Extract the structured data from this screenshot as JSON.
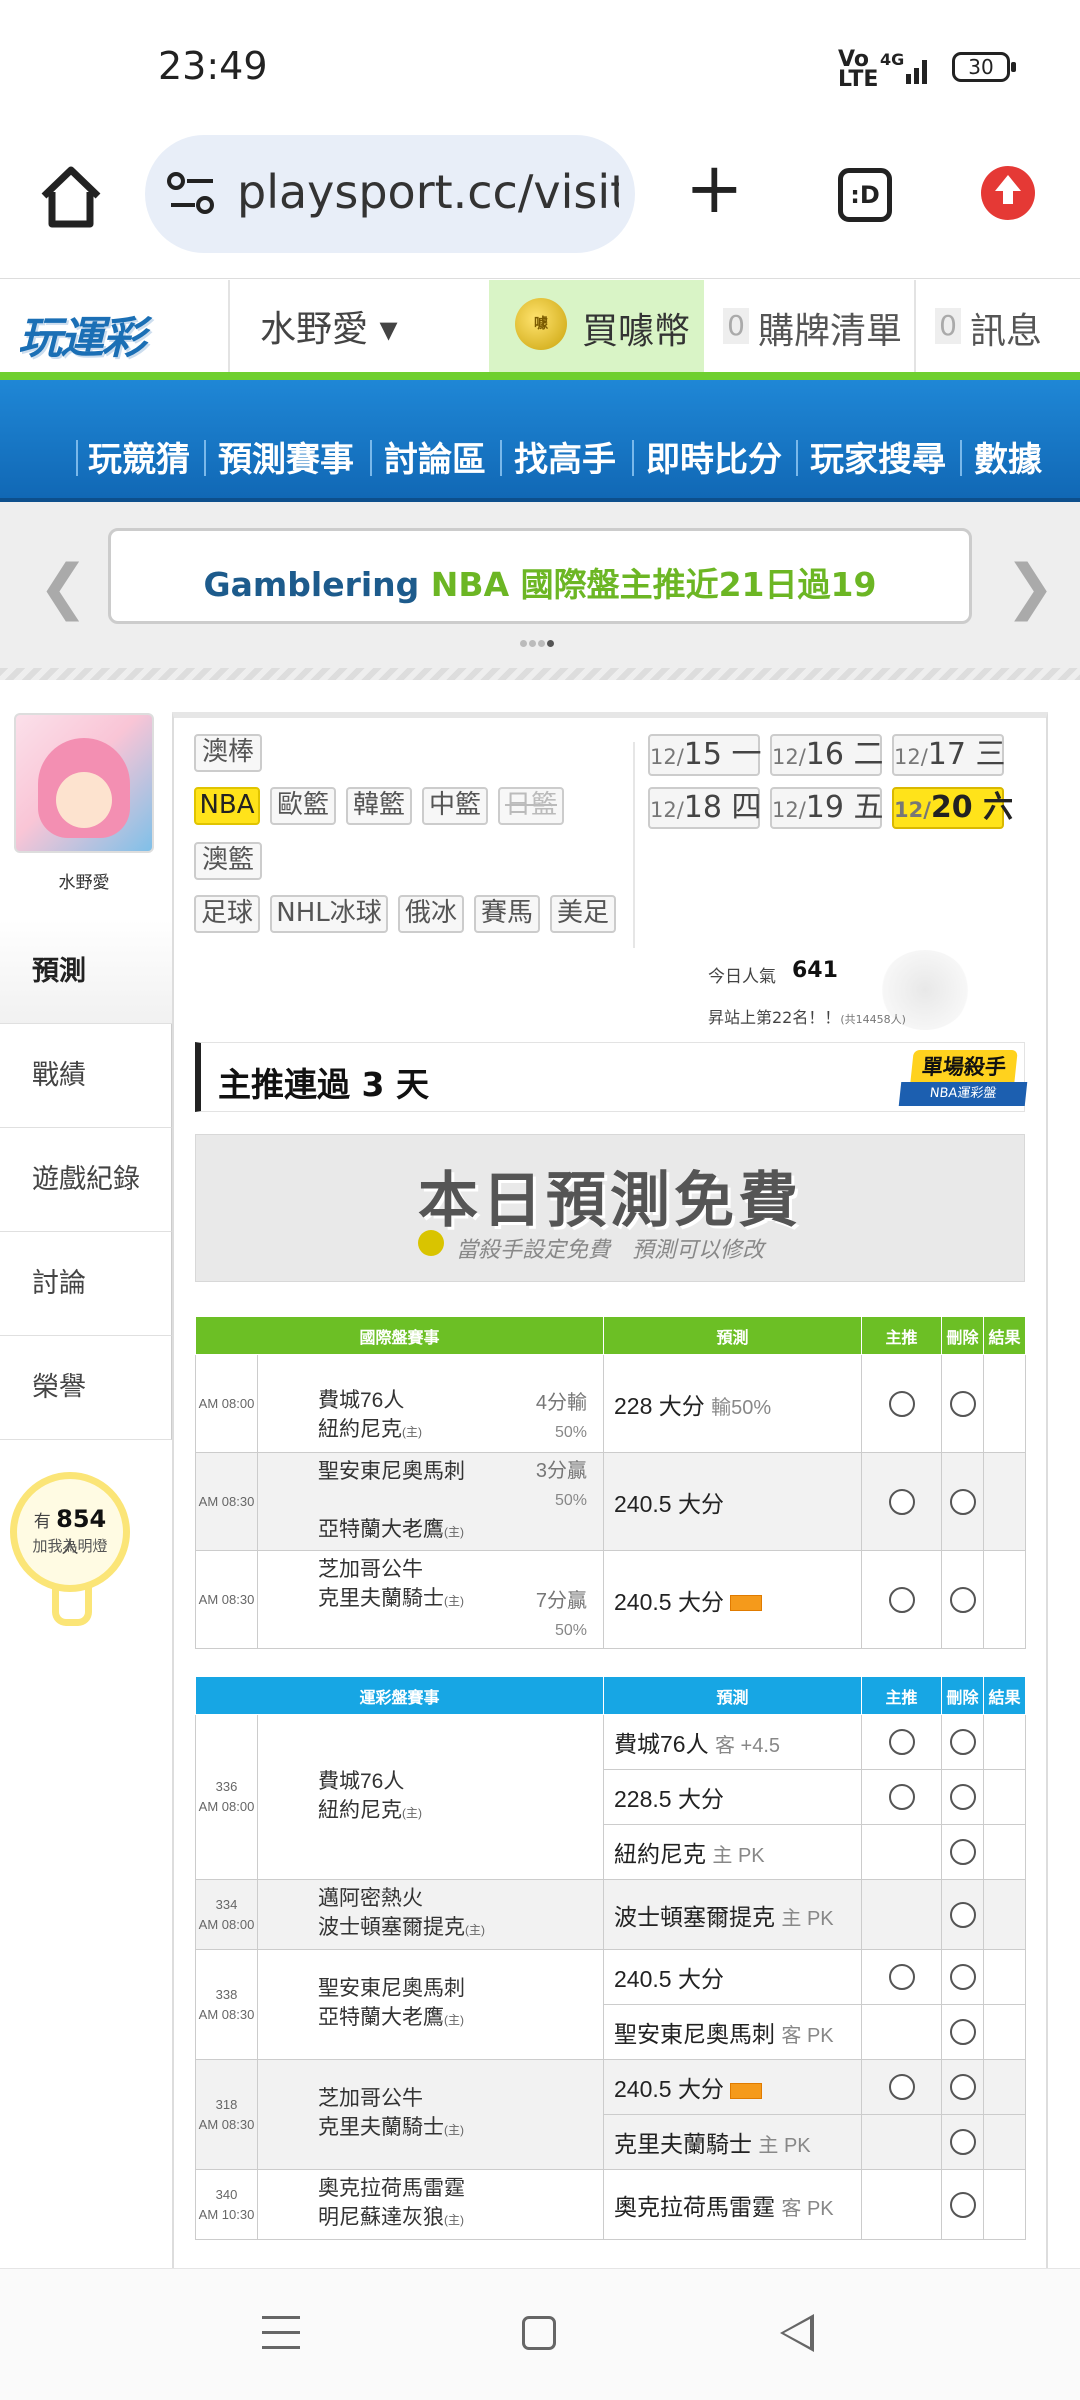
{
  "status_bar": {
    "time": "23:49",
    "network_top": "Vo",
    "network_bottom": "LTE",
    "signal": "4G",
    "battery": "30"
  },
  "browser": {
    "url": "playsport.cc/visit",
    "tabs_icon_label": ":D"
  },
  "site_header": {
    "logo": "玩運彩",
    "username": "水野愛 ▾",
    "buy_coins": "買噱幣",
    "coin_badge": "噱",
    "cart_count": "0",
    "cart_label": "購牌清單",
    "message_count": "0",
    "message_label": "訊息",
    "colors": {
      "brand_blue": "#1b6fb5",
      "accent_green": "#6cbf25"
    }
  },
  "nav": [
    "玩競猜",
    "預測賽事",
    "討論區",
    "找高手",
    "即時比分",
    "玩家搜尋",
    "數據"
  ],
  "banner": {
    "part1": "Gamblering",
    "part2": "NBA 國際盤主推近21日過19"
  },
  "profile": {
    "name": "水野愛"
  },
  "side_tabs": [
    "預測",
    "戰績",
    "遊戲紀錄",
    "討論",
    "榮譽"
  ],
  "fans": {
    "prefix": "有",
    "count": "854",
    "suffix": "人",
    "line2": "加我為明燈"
  },
  "leagues": {
    "row1": [
      "澳棒"
    ],
    "row2": [
      "NBA",
      "歐籃",
      "韓籃",
      "中籃",
      "日籃"
    ],
    "row3": [
      "澳籃"
    ],
    "row4": [
      "足球",
      "NHL冰球",
      "俄冰",
      "賽馬",
      "美足"
    ]
  },
  "dates": [
    {
      "md": "12/",
      "day": "15",
      "wd": "一"
    },
    {
      "md": "12/",
      "day": "16",
      "wd": "二"
    },
    {
      "md": "12/",
      "day": "17",
      "wd": "三"
    },
    {
      "md": "12/",
      "day": "18",
      "wd": "四"
    },
    {
      "md": "12/",
      "day": "19",
      "wd": "五"
    },
    {
      "md": "12/",
      "day": "20",
      "wd": "六"
    }
  ],
  "popularity": {
    "label": "今日人氣",
    "value": "641",
    "rank": "昇站上第22名！！",
    "rank_note": "(共14458人)"
  },
  "streak": {
    "text": "主推連過 3 天",
    "badge_top": "單場殺手",
    "badge_bottom": "NBA運彩盤"
  },
  "free": {
    "title": "本日預測免費",
    "subtitle": "當殺手設定免費　預測可以修改"
  },
  "intl_table": {
    "headers": [
      "國際盤賽事",
      "預測",
      "主推",
      "刪除",
      "結果"
    ],
    "rows": [
      {
        "time": "AM 08:00",
        "team1": "費城76人",
        "team2": "紐約尼克",
        "home_mark": "(主)",
        "spread": "4分輸",
        "spread_pct": "50%",
        "pick": "228 大分",
        "pick_note": "輸50%"
      },
      {
        "time": "AM 08:30",
        "team1": "聖安東尼奧馬刺",
        "team2": "亞特蘭大老鷹",
        "home_mark": "(主)",
        "spread": "3分贏",
        "spread_pct": "50%",
        "pick": "240.5 大分",
        "pick_note": ""
      },
      {
        "time": "AM 08:30",
        "team1": "芝加哥公牛",
        "team2": "克里夫蘭騎士",
        "home_mark": "(主)",
        "spread": "7分贏",
        "spread_pct": "50%",
        "pick": "240.5 大分",
        "pick_note": ""
      }
    ]
  },
  "lottery_table": {
    "headers": [
      "運彩盤賽事",
      "預測",
      "主推",
      "刪除",
      "結果"
    ],
    "games": [
      {
        "num": "336",
        "time": "AM 08:00",
        "team1": "費城76人",
        "team2": "紐約尼克",
        "home_mark": "(主)",
        "picks": [
          {
            "text": "費城76人",
            "note": "客 +4.5"
          },
          {
            "text": "228.5 大分",
            "note": ""
          },
          {
            "text": "紐約尼克",
            "note": "主 PK"
          }
        ]
      },
      {
        "num": "334",
        "time": "AM 08:00",
        "team1": "邁阿密熱火",
        "team2": "波士頓塞爾提克",
        "home_mark": "(主)",
        "picks": [
          {
            "text": "波士頓塞爾提克",
            "note": "主 PK"
          }
        ]
      },
      {
        "num": "338",
        "time": "AM 08:30",
        "team1": "聖安東尼奧馬刺",
        "team2": "亞特蘭大老鷹",
        "home_mark": "(主)",
        "picks": [
          {
            "text": "240.5 大分",
            "note": ""
          },
          {
            "text": "聖安東尼奧馬刺",
            "note": "客 PK"
          }
        ]
      },
      {
        "num": "318",
        "time": "AM 08:30",
        "team1": "芝加哥公牛",
        "team2": "克里夫蘭騎士",
        "home_mark": "(主)",
        "picks": [
          {
            "text": "240.5 大分",
            "note": ""
          },
          {
            "text": "克里夫蘭騎士",
            "note": "主 PK"
          }
        ]
      },
      {
        "num": "340",
        "time": "AM 10:30",
        "team1": "奧克拉荷馬雷霆",
        "team2": "明尼蘇達灰狼",
        "home_mark": "(主)",
        "picks": [
          {
            "text": "奧克拉荷馬雷霆",
            "note": "客 PK"
          }
        ]
      }
    ]
  }
}
